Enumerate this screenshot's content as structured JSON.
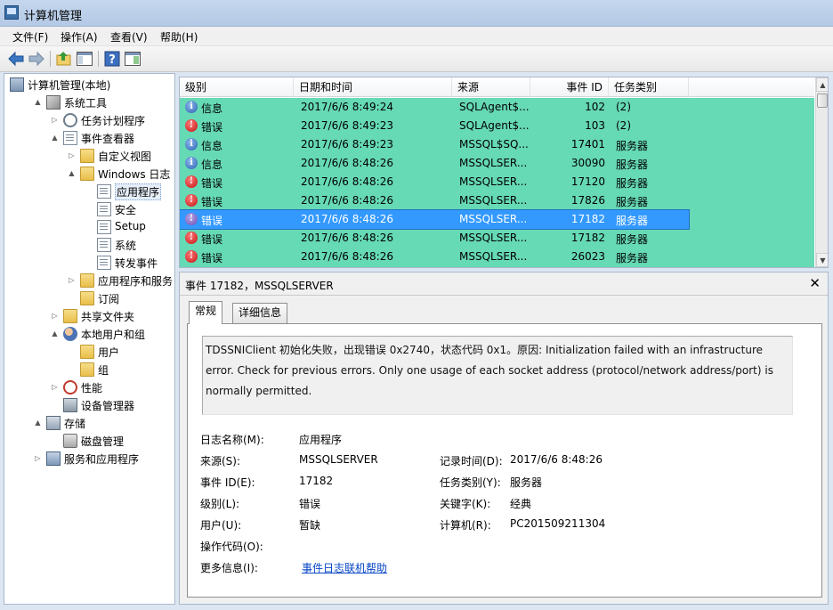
{
  "window": {
    "title": "计算机管理"
  },
  "menu": [
    "文件(F)",
    "操作(A)",
    "查看(V)",
    "帮助(H)"
  ],
  "toolbar": {
    "icons": [
      "back-arrow-icon",
      "forward-arrow-icon",
      "up-folder-icon",
      "show-hide-tree-icon",
      "help-icon",
      "show-hide-action-pane-icon"
    ]
  },
  "tree": {
    "items": [
      {
        "label": "计算机管理(本地)",
        "icon": "computer-icon",
        "toggle": ""
      },
      {
        "label": "系统工具",
        "icon": "tools-icon",
        "toggle": "▲"
      },
      {
        "label": "任务计划程序",
        "icon": "clock-icon",
        "toggle": "▷"
      },
      {
        "label": "事件查看器",
        "icon": "event-viewer-icon",
        "toggle": "▲"
      },
      {
        "label": "自定义视图",
        "icon": "folder-icon",
        "toggle": "▷"
      },
      {
        "label": "Windows 日志",
        "icon": "folder-icon",
        "toggle": "▲"
      },
      {
        "label": "应用程序",
        "icon": "log-icon",
        "toggle": ""
      },
      {
        "label": "安全",
        "icon": "log-icon",
        "toggle": ""
      },
      {
        "label": "Setup",
        "icon": "log-icon",
        "toggle": ""
      },
      {
        "label": "系统",
        "icon": "log-icon",
        "toggle": ""
      },
      {
        "label": "转发事件",
        "icon": "log-icon",
        "toggle": ""
      },
      {
        "label": "应用程序和服务日志",
        "icon": "folder-icon",
        "toggle": "▷"
      },
      {
        "label": "订阅",
        "icon": "folder-icon",
        "toggle": ""
      },
      {
        "label": "共享文件夹",
        "icon": "folder-icon",
        "toggle": "▷"
      },
      {
        "label": "本地用户和组",
        "icon": "users-icon",
        "toggle": "▲"
      },
      {
        "label": "用户",
        "icon": "folder-icon",
        "toggle": ""
      },
      {
        "label": "组",
        "icon": "folder-icon",
        "toggle": ""
      },
      {
        "label": "性能",
        "icon": "performance-icon",
        "toggle": "▷"
      },
      {
        "label": "设备管理器",
        "icon": "device-manager-icon",
        "toggle": ""
      },
      {
        "label": "存储",
        "icon": "storage-icon",
        "toggle": "▲"
      },
      {
        "label": "磁盘管理",
        "icon": "disk-icon",
        "toggle": ""
      },
      {
        "label": "服务和应用程序",
        "icon": "services-icon",
        "toggle": "▷"
      }
    ]
  },
  "events": {
    "columns": {
      "level": "级别",
      "date": "日期和时间",
      "source": "来源",
      "event_id": "事件 ID",
      "category": "任务类别"
    },
    "rows": [
      {
        "level": "信息",
        "type": "info",
        "date": "2017/6/6 8:49:24",
        "source": "SQLAgent$...",
        "event_id": "102",
        "category": "(2)"
      },
      {
        "level": "错误",
        "type": "error",
        "date": "2017/6/6 8:49:23",
        "source": "SQLAgent$...",
        "event_id": "103",
        "category": "(2)"
      },
      {
        "level": "信息",
        "type": "info",
        "date": "2017/6/6 8:49:23",
        "source": "MSSQL$SQ...",
        "event_id": "17401",
        "category": "服务器"
      },
      {
        "level": "信息",
        "type": "info",
        "date": "2017/6/6 8:48:26",
        "source": "MSSQLSER...",
        "event_id": "30090",
        "category": "服务器"
      },
      {
        "level": "错误",
        "type": "error",
        "date": "2017/6/6 8:48:26",
        "source": "MSSQLSER...",
        "event_id": "17120",
        "category": "服务器"
      },
      {
        "level": "错误",
        "type": "error",
        "date": "2017/6/6 8:48:26",
        "source": "MSSQLSER...",
        "event_id": "17826",
        "category": "服务器"
      },
      {
        "level": "错误",
        "type": "error",
        "date": "2017/6/6 8:48:26",
        "source": "MSSQLSER...",
        "event_id": "17182",
        "category": "服务器",
        "selected": true
      },
      {
        "level": "错误",
        "type": "error",
        "date": "2017/6/6 8:48:26",
        "source": "MSSQLSER...",
        "event_id": "17182",
        "category": "服务器"
      },
      {
        "level": "错误",
        "type": "error",
        "date": "2017/6/6 8:48:26",
        "source": "MSSQLSER...",
        "event_id": "26023",
        "category": "服务器"
      }
    ]
  },
  "detail": {
    "title": "事件 17182，MSSQLSERVER",
    "tabs": [
      "常规",
      "详细信息"
    ],
    "message": "TDSSNIClient 初始化失败，出现错误 0x2740，状态代码 0x1。原因: Initialization failed with an infrastructure error. Check for previous errors. Only one usage of each socket address (protocol/network address/port) is normally permitted.",
    "fields": {
      "log_name_label": "日志名称(M):",
      "log_name": "应用程序",
      "source_label": "来源(S):",
      "source": "MSSQLSERVER",
      "logged_label": "记录时间(D):",
      "logged": "2017/6/6 8:48:26",
      "event_id_label": "事件 ID(E):",
      "event_id": "17182",
      "task_category_label": "任务类别(Y):",
      "task_category": "服务器",
      "level_label": "级别(L):",
      "level": "错误",
      "keywords_label": "关键字(K):",
      "keywords": "经典",
      "user_label": "用户(U):",
      "user": "暂缺",
      "computer_label": "计算机(R):",
      "computer": "PC201509211304",
      "opcode_label": "操作代码(O):",
      "more_info_label": "更多信息(I):",
      "more_info_link": "事件日志联机帮助"
    }
  },
  "colors": {
    "list_highlight": "#66d9b5",
    "selection": "#3399ff",
    "link": "#0645c5"
  }
}
